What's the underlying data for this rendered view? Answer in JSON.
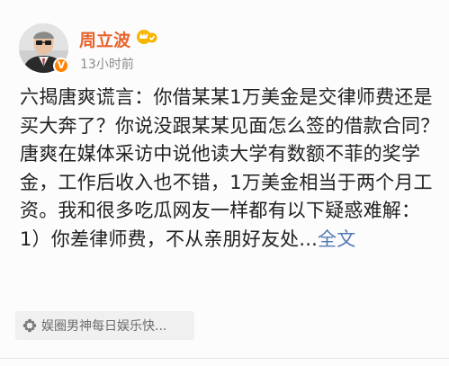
{
  "post": {
    "author": {
      "name": "周立波",
      "avatar_icon": "user-avatar-icon",
      "verified_icon": "vip-verified-icon",
      "level_icon": "crown-level-icon"
    },
    "timestamp": "13小时前",
    "paragraphs": [
      "六揭唐爽谎言：你借某某1万美金是交律师费还是买大奔了？你说没跟某某见面怎么签的借款合同？",
      "唐爽在媒体采访中说他读大学有数额不菲的奖学金，工作后收入也不错，1万美金相当于两个月工资。我和很多吃瓜网友一样都有以下疑惑难解：1）你差律师费，不从亲朋好友处..."
    ],
    "expand_label": "全文",
    "tag": {
      "icon": "topic-flower-icon",
      "label": "娱圈男神每日娱乐快..."
    }
  },
  "colors": {
    "username": "#e8632c",
    "link": "#5078b4",
    "timestamp": "#8c8c8c",
    "vip_badge": "#ff8200"
  }
}
